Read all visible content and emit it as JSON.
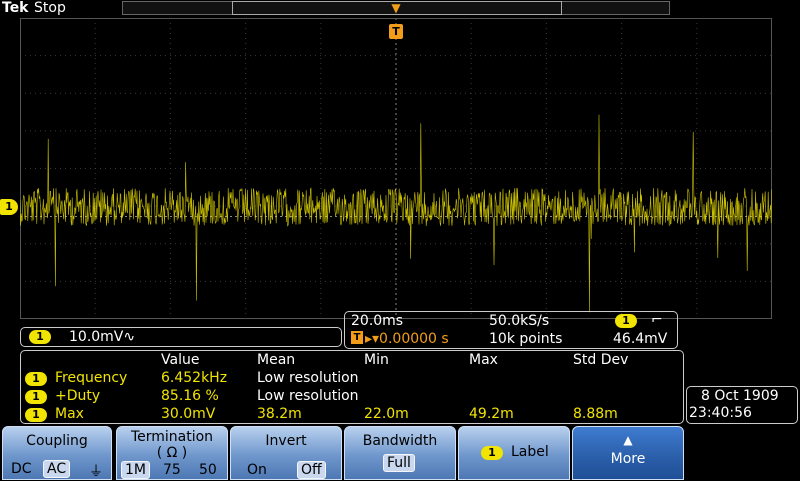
{
  "header": {
    "brand": "Tek",
    "run_state": "Stop"
  },
  "trigger_marker": "T",
  "channel_marker": "1",
  "channel_readout": {
    "channel": "1",
    "scale": "10.0mV",
    "bw_symbol": "∿"
  },
  "timebase": {
    "scale": "20.0ms",
    "sample_rate": "50.0kS/s",
    "trigger_symbol": "T",
    "delay": "▸▾0.00000 s",
    "record_length": "10k points",
    "trigger_channel": "1",
    "slope_symbol": "⌐",
    "trigger_level": "46.4mV"
  },
  "measurements": {
    "headers": [
      "Value",
      "Mean",
      "Min",
      "Max",
      "Std Dev"
    ],
    "rows": [
      {
        "channel": "1",
        "name": "Frequency",
        "value": "6.452kHz",
        "mean": "Low resolution",
        "min": "",
        "max": "",
        "std": ""
      },
      {
        "channel": "1",
        "name": "+Duty",
        "value": "85.16 %",
        "mean": "Low resolution",
        "min": "",
        "max": "",
        "std": ""
      },
      {
        "channel": "1",
        "name": "Max",
        "value": "30.0mV",
        "mean": "38.2m",
        "min": "22.0m",
        "max": "49.2m",
        "std": "8.88m"
      }
    ]
  },
  "datetime": {
    "date": "8 Oct  1909",
    "time": "23:40:56"
  },
  "menu": {
    "coupling": {
      "title": "Coupling",
      "opt1": "DC",
      "opt2": "AC",
      "opt3": "⏚"
    },
    "termination": {
      "title": "Termination",
      "subtitle": "( Ω )",
      "opt1": "1M",
      "opt2": "75",
      "opt3": "50"
    },
    "invert": {
      "title": "Invert",
      "opt1": "On",
      "opt2": "Off"
    },
    "bandwidth": {
      "title": "Bandwidth",
      "value": "Full"
    },
    "label": {
      "channel": "1",
      "title": "Label"
    },
    "more": {
      "title": "More",
      "arrow": "▲"
    }
  },
  "colors": {
    "trace": "#f0e400",
    "trigger": "#f29d1a",
    "menu": "#6f97cc"
  }
}
